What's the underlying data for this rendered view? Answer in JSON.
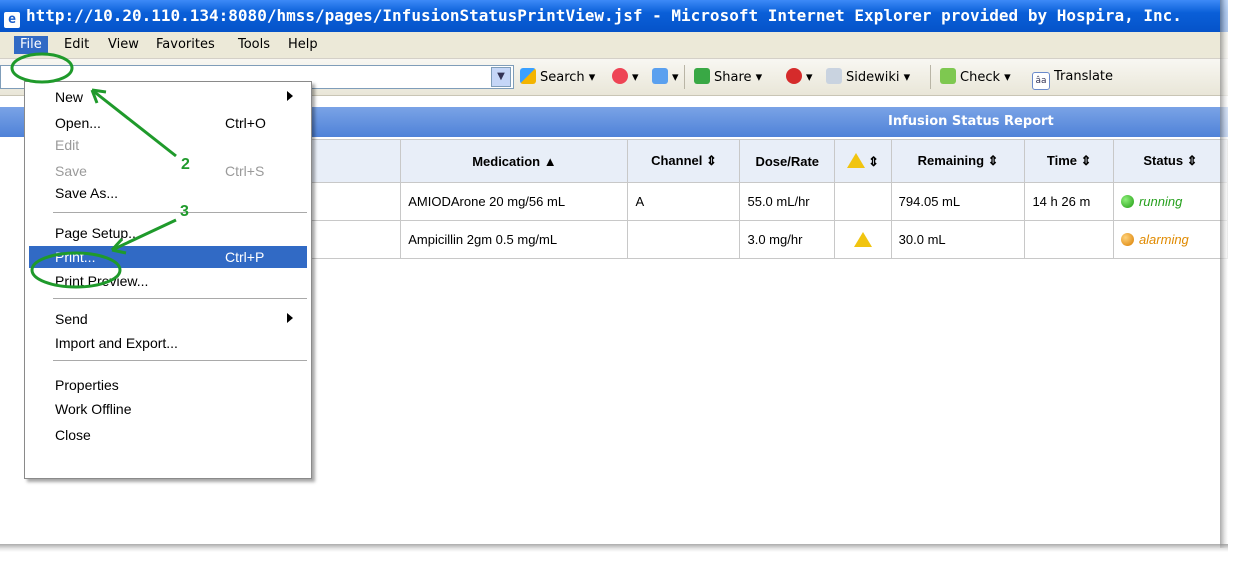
{
  "window": {
    "title": "http://10.20.110.134:8080/hmss/pages/InfusionStatusPrintView.jsf - Microsoft Internet Explorer provided by Hospira, Inc."
  },
  "menubar": [
    "File",
    "Edit",
    "View",
    "Favorites",
    "Tools",
    "Help"
  ],
  "toolbar": {
    "search": "Search",
    "share": "Share",
    "sidewiki": "Sidewiki",
    "check": "Check",
    "translate": "Translate"
  },
  "file_menu": {
    "items": [
      {
        "label": "New",
        "shortcut": "",
        "submenu": true,
        "disabled": false
      },
      {
        "label": "Open...",
        "shortcut": "Ctrl+O",
        "submenu": false,
        "disabled": false
      },
      {
        "label": "Edit",
        "shortcut": "",
        "submenu": false,
        "disabled": true
      },
      {
        "label": "Save",
        "shortcut": "Ctrl+S",
        "submenu": false,
        "disabled": true
      },
      {
        "label": "Save As...",
        "shortcut": "",
        "submenu": false,
        "disabled": false
      },
      {
        "label": "Page Setup...",
        "shortcut": "",
        "submenu": false,
        "disabled": false
      },
      {
        "label": "Print...",
        "shortcut": "Ctrl+P",
        "submenu": false,
        "disabled": false,
        "highlighted": true
      },
      {
        "label": "Print Preview...",
        "shortcut": "",
        "submenu": false,
        "disabled": false
      },
      {
        "label": "Send",
        "shortcut": "",
        "submenu": true,
        "disabled": false
      },
      {
        "label": "Import and Export...",
        "shortcut": "",
        "submenu": false,
        "disabled": false
      },
      {
        "label": "Properties",
        "shortcut": "",
        "submenu": false,
        "disabled": false
      },
      {
        "label": "Work Offline",
        "shortcut": "",
        "submenu": false,
        "disabled": false
      },
      {
        "label": "Close",
        "shortcut": "",
        "submenu": false,
        "disabled": false
      }
    ]
  },
  "callouts": {
    "step2": "2",
    "step3": "3"
  },
  "report": {
    "title": "Infusion Status Report",
    "columns": [
      "Medication ▲",
      "Channel ⇕",
      "Dose/Rate",
      "",
      "Remaining ⇕",
      "Time ⇕",
      "Status ⇕"
    ],
    "rows": [
      {
        "medication": "AMIODArone 20 mg/56 mL",
        "channel": "A",
        "dose_rate": "55.0 mL/hr",
        "alert": false,
        "remaining": "794.05 mL",
        "time": "14 h 26 m",
        "status": "running"
      },
      {
        "medication": "Ampicillin 2gm 0.5 mg/mL",
        "channel": "",
        "dose_rate": "3.0 mg/hr",
        "alert": true,
        "remaining": "30.0 mL",
        "time": "",
        "status": "alarming"
      }
    ]
  },
  "colors": {
    "running": "#27a01e",
    "alarming": "#e08a00",
    "highlight": "#316ac5",
    "callout": "#1f9a2b"
  }
}
